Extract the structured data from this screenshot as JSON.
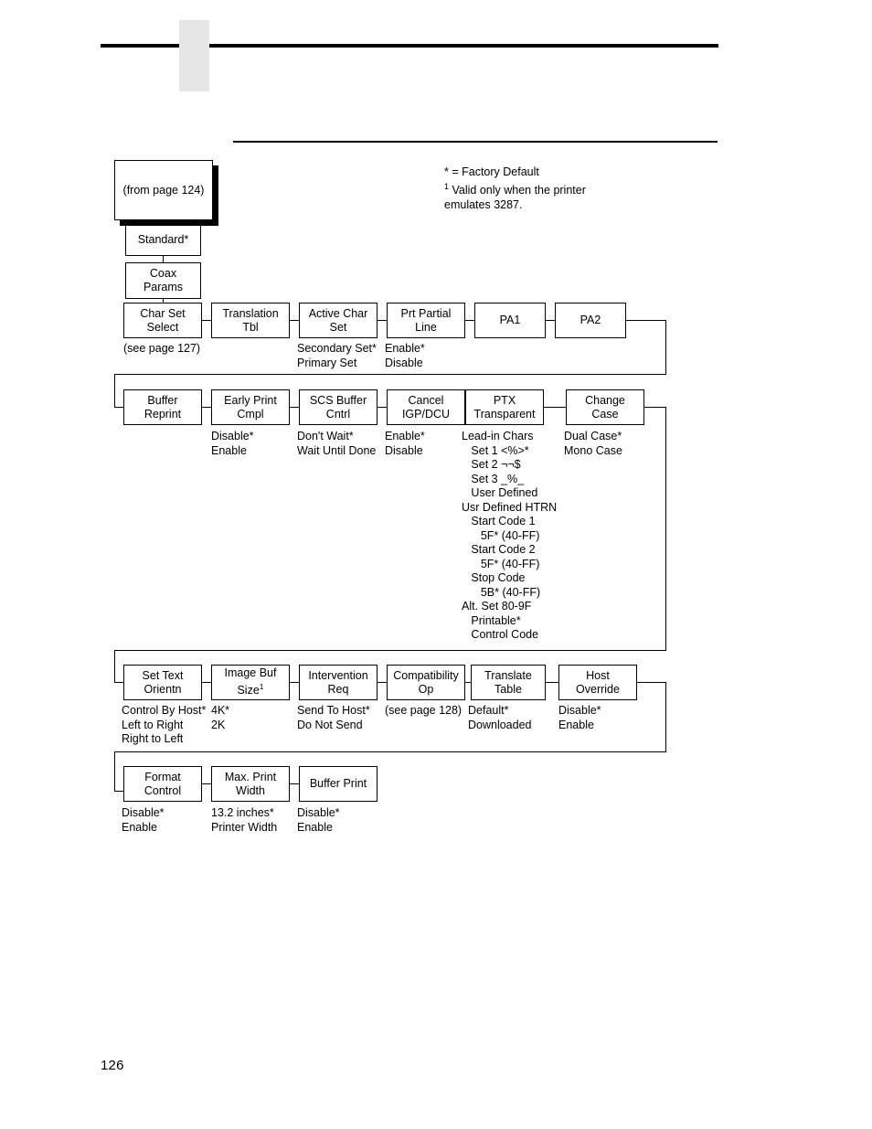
{
  "page": {
    "number": "126",
    "legend": [
      "* = Factory Default",
      "1 Valid only when the printer",
      "emulates 3287."
    ],
    "legend_line1": "* = Factory Default",
    "legend_line2_sup": "1",
    "legend_line2": " Valid only when the printer",
    "legend_line3": "emulates 3287."
  },
  "diagram": {
    "type": "menu-flowchart",
    "entry": {
      "label": "(from page 124)"
    },
    "trunk": [
      {
        "label": "Standard*"
      },
      {
        "label": "Coax\nParams"
      }
    ],
    "rows": [
      {
        "id": "row-1",
        "nodes": [
          {
            "name": "char-set-select",
            "line1": "Char Set",
            "line2": "Select",
            "options": "(see page 127)"
          },
          {
            "name": "translation-tbl",
            "line1": "Translation",
            "line2": "Tbl",
            "options": ""
          },
          {
            "name": "active-char-set",
            "line1": "Active Char",
            "line2": "Set",
            "options": "Secondary Set*\nPrimary Set"
          },
          {
            "name": "prt-partial-line",
            "line1": "Prt Partial",
            "line2": "Line",
            "options": "Enable*\nDisable"
          },
          {
            "name": "pa1",
            "line1": "PA1",
            "line2": "",
            "options": ""
          },
          {
            "name": "pa2",
            "line1": "PA2",
            "line2": "",
            "options": ""
          }
        ]
      },
      {
        "id": "row-2",
        "nodes": [
          {
            "name": "buffer-reprint",
            "line1": "Buffer",
            "line2": "Reprint",
            "options": ""
          },
          {
            "name": "early-print-cmpl",
            "line1": "Early Print",
            "line2": "Cmpl",
            "options": "Disable*\nEnable"
          },
          {
            "name": "scs-buffer-cntrl",
            "line1": "SCS Buffer",
            "line2": "Cntrl",
            "options": "Don't Wait*\nWait Until Done"
          },
          {
            "name": "cancel-igp-dcu",
            "line1": "Cancel",
            "line2": "IGP/DCU",
            "options": "Enable*\nDisable"
          },
          {
            "name": "ptx-transparent",
            "line1": "PTX",
            "line2": "Transparent",
            "options": "Lead-in Chars\n   Set 1 <%>*\n   Set 2 ¬¬$\n   Set 3 _%_\n   User Defined\nUsr Defined HTRN\n   Start Code 1\n      5F* (40-FF)\n   Start Code 2\n      5F* (40-FF)\n   Stop Code\n      5B* (40-FF)\nAlt. Set 80-9F\n   Printable*\n   Control Code"
          },
          {
            "name": "change-case",
            "line1": "Change",
            "line2": "Case",
            "options": "Dual Case*\nMono Case"
          }
        ]
      },
      {
        "id": "row-3",
        "nodes": [
          {
            "name": "set-text-orientn",
            "line1": "Set Text",
            "line2": "Orientn",
            "options": "Control By Host*\nLeft to Right\nRight to Left"
          },
          {
            "name": "image-buf-size",
            "line1": "Image Buf",
            "line2": "Size",
            "sup": "1",
            "options": "4K*\n2K"
          },
          {
            "name": "intervention-req",
            "line1": "Intervention",
            "line2": "Req",
            "options": "Send To Host*\nDo Not Send"
          },
          {
            "name": "compatibility-op",
            "line1": "Compatibility",
            "line2": "Op",
            "options": "(see page 128)"
          },
          {
            "name": "translate-table",
            "line1": "Translate",
            "line2": "Table",
            "options": "Default*\nDownloaded"
          },
          {
            "name": "host-override",
            "line1": "Host",
            "line2": "Override",
            "options": "Disable*\nEnable"
          }
        ]
      },
      {
        "id": "row-4",
        "nodes": [
          {
            "name": "format-control",
            "line1": "Format",
            "line2": "Control",
            "options": "Disable*\nEnable"
          },
          {
            "name": "max-print-width",
            "line1": "Max. Print",
            "line2": "Width",
            "options": "13.2 inches*\nPrinter Width"
          },
          {
            "name": "buffer-print",
            "line1": "Buffer Print",
            "line2": "",
            "options": "Disable*\nEnable"
          }
        ]
      }
    ]
  }
}
